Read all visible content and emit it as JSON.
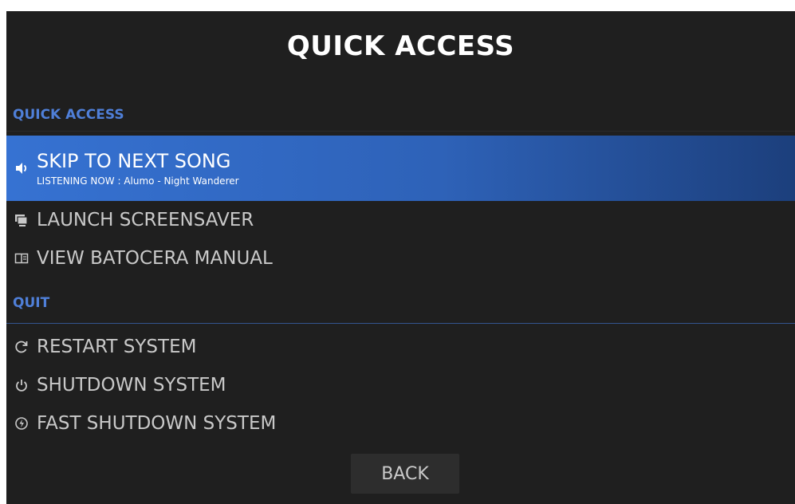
{
  "menu": {
    "title": "QUICK ACCESS",
    "sections": [
      {
        "header": "QUICK ACCESS",
        "items": [
          {
            "label": "SKIP TO NEXT SONG",
            "subtitle": "LISTENING NOW : Alumo - Night Wanderer",
            "icon": "speaker-icon",
            "selected": true
          },
          {
            "label": "LAUNCH SCREENSAVER",
            "icon": "screensaver-icon"
          },
          {
            "label": "VIEW BATOCERA MANUAL",
            "icon": "manual-icon"
          }
        ]
      },
      {
        "header": "QUIT",
        "items": [
          {
            "label": "RESTART SYSTEM",
            "icon": "restart-icon"
          },
          {
            "label": "SHUTDOWN SYSTEM",
            "icon": "power-icon"
          },
          {
            "label": "FAST SHUTDOWN SYSTEM",
            "icon": "fast-power-icon"
          }
        ]
      }
    ],
    "back_label": "BACK",
    "colors": {
      "background": "#1f1f1f",
      "section_header": "#4f7fd8",
      "selection_start": "#3672d2",
      "selection_end": "#1c3f7c",
      "item_text": "#c9c9c9"
    }
  }
}
